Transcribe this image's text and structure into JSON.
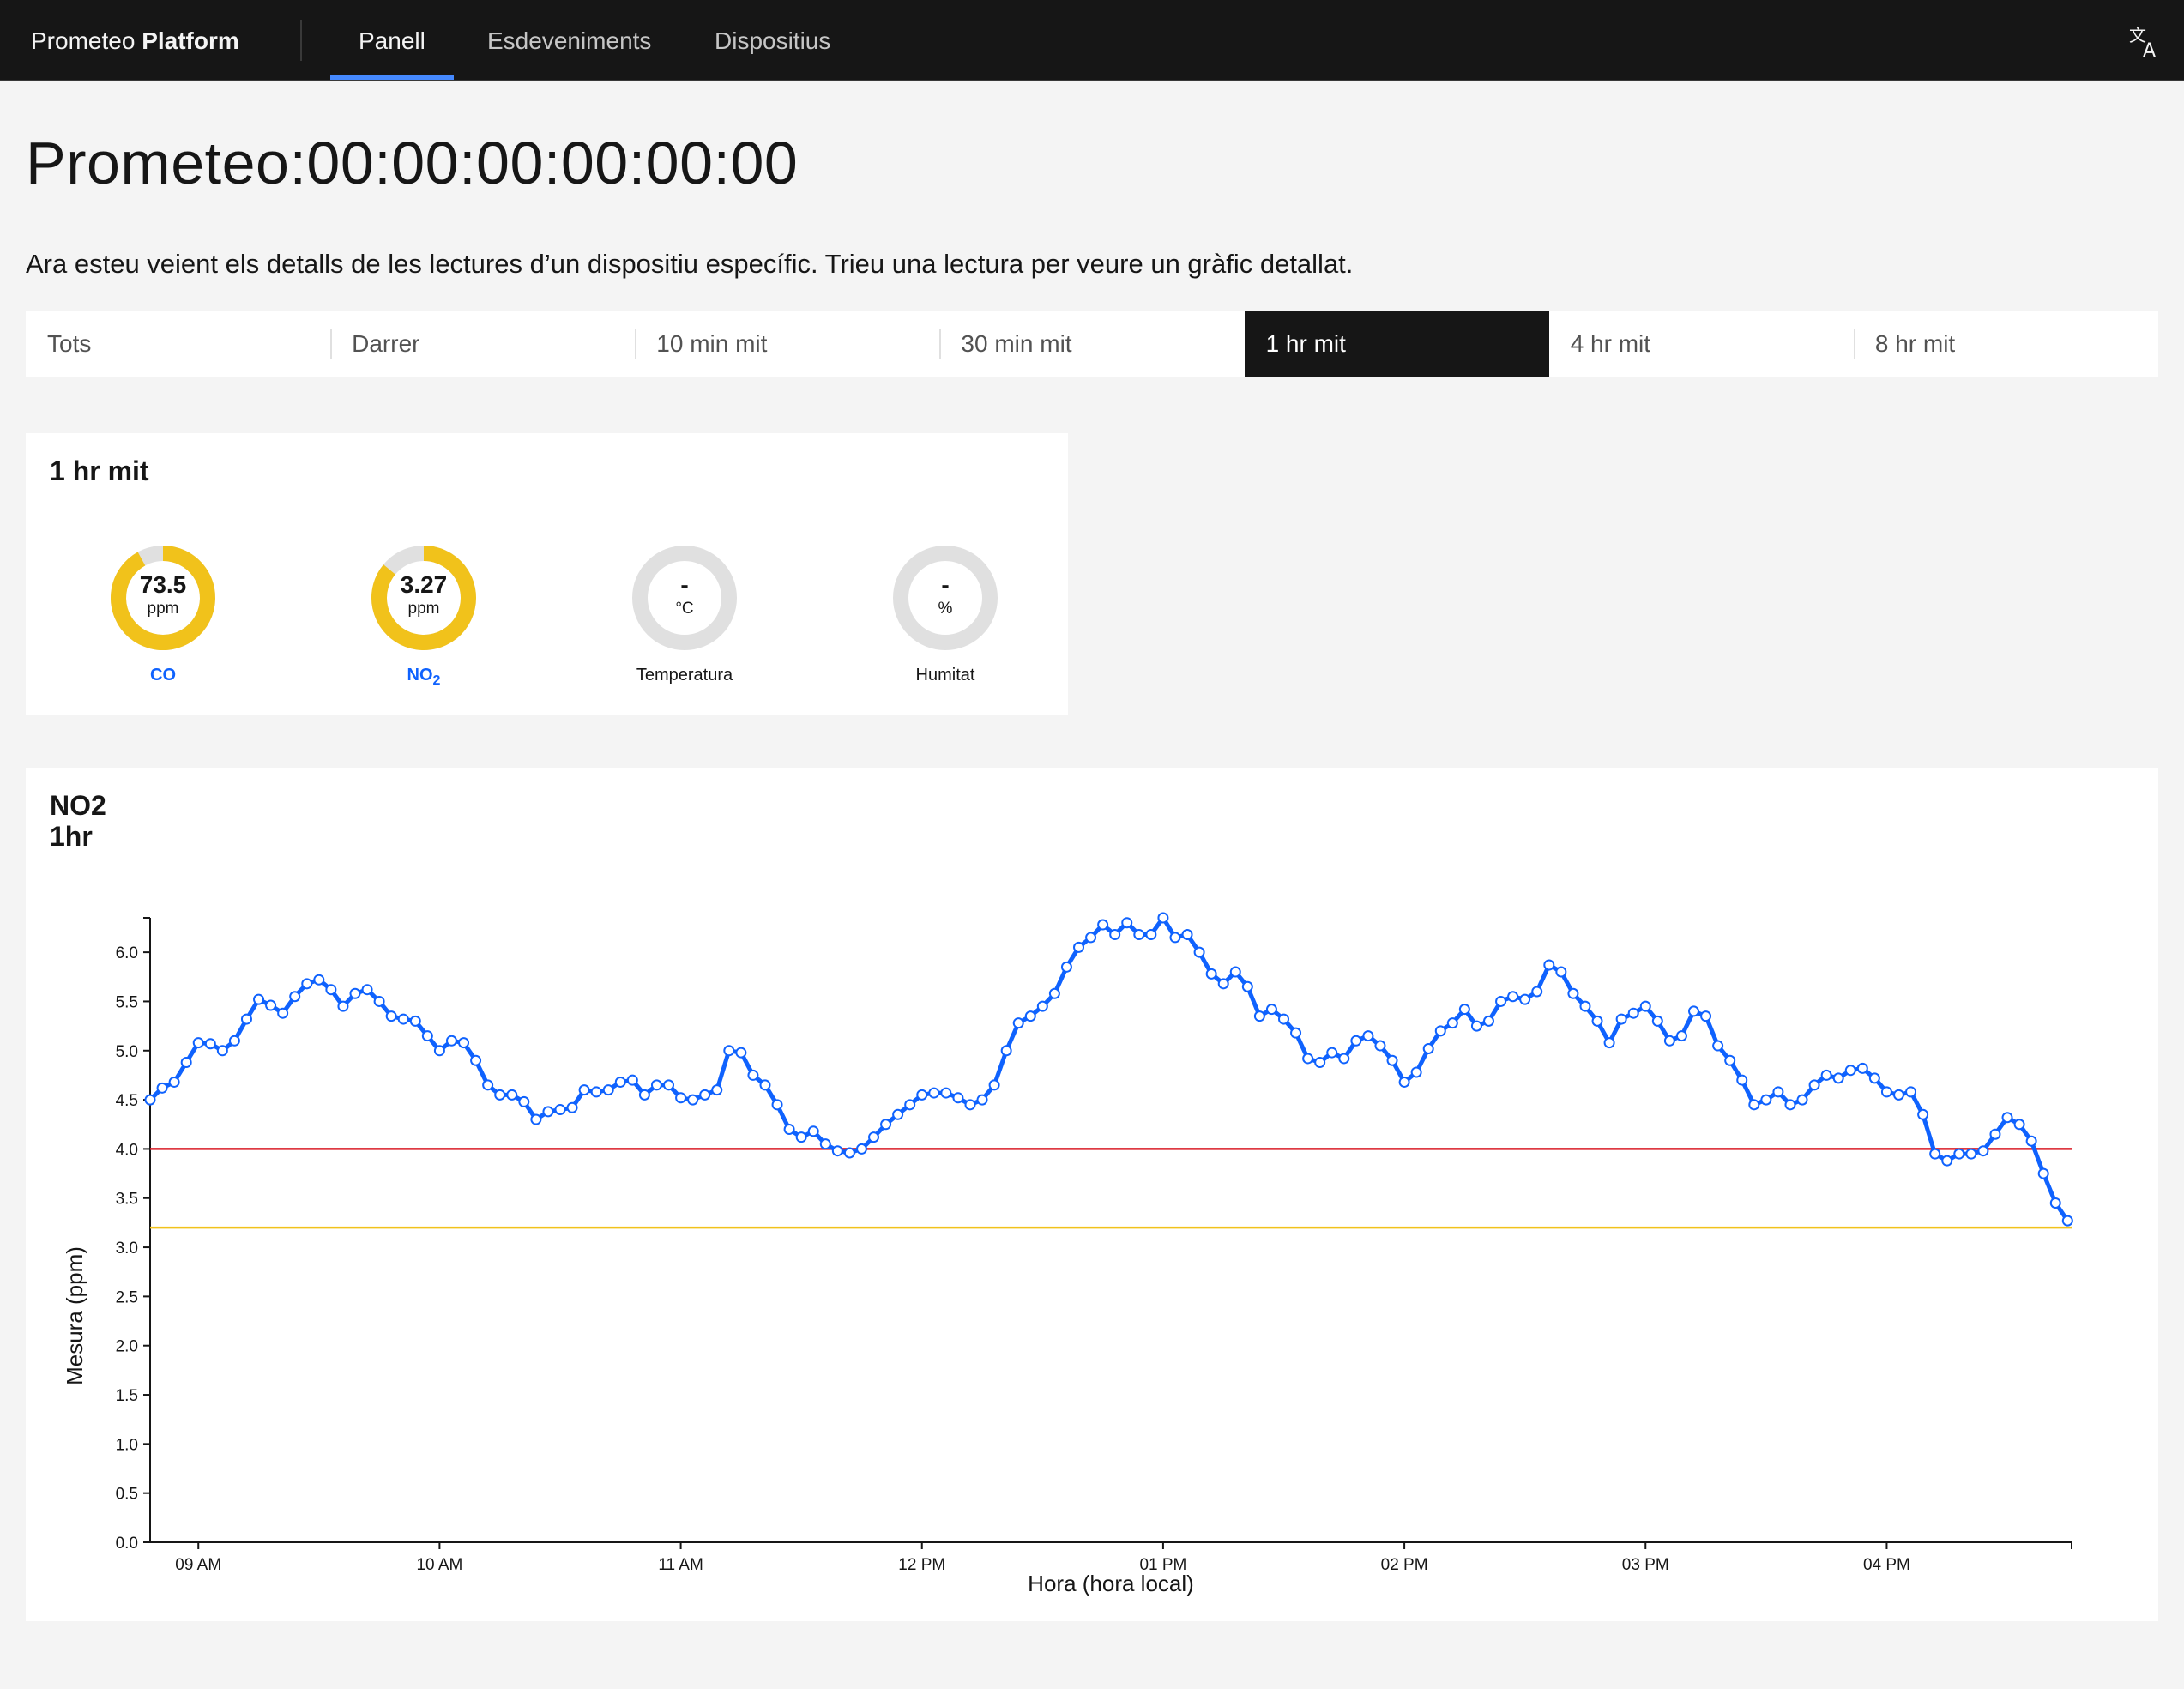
{
  "header": {
    "brand_prefix": "Prometeo",
    "brand_bold": "Platform",
    "nav": [
      {
        "label": "Panell",
        "active": true
      },
      {
        "label": "Esdeveniments",
        "active": false
      },
      {
        "label": "Dispositius",
        "active": false
      }
    ],
    "language_icon": "translate-icon"
  },
  "page": {
    "title": "Prometeo:00:00:00:00:00:00",
    "description": "Ara esteu veient els detalls de les lectures d’un dispositiu específic. Trieu una lectura per veure un gràfic detallat."
  },
  "tabs": [
    {
      "label": "Tots",
      "active": false
    },
    {
      "label": "Darrer",
      "active": false
    },
    {
      "label": "10 min mit",
      "active": false
    },
    {
      "label": "30 min mit",
      "active": false
    },
    {
      "label": "1 hr mit",
      "active": true
    },
    {
      "label": "4 hr mit",
      "active": false
    },
    {
      "label": "8 hr mit",
      "active": false
    }
  ],
  "gauge_card": {
    "title": "1 hr mit",
    "gauges": [
      {
        "value": "73.5",
        "unit": "ppm",
        "label": "CO",
        "fill_fraction": 0.92,
        "color": "#f1c21b"
      },
      {
        "value": "3.27",
        "unit": "ppm",
        "label": "NO",
        "label_sub": "2",
        "fill_fraction": 0.86,
        "color": "#f1c21b"
      },
      {
        "value": "-",
        "unit": "°C",
        "label": "Temperatura",
        "fill_fraction": 0,
        "color": "#e0e0e0"
      },
      {
        "value": "-",
        "unit": "%",
        "label": "Humitat",
        "fill_fraction": 0,
        "color": "#e0e0e0"
      }
    ]
  },
  "colors": {
    "accent": "#0f62fe",
    "series": "#0f62fe",
    "warning_line": "#da1e28",
    "caution_line": "#f1c21b",
    "gauge_fill": "#f1c21b",
    "gauge_track": "#e0e0e0"
  },
  "chart_data": {
    "type": "line",
    "title": "NO2",
    "subtitle": "1hr",
    "xlabel": "Hora (hora local)",
    "ylabel": "Mesura (ppm)",
    "x_ticks": [
      "09 AM",
      "10 AM",
      "11 AM",
      "12 PM",
      "01 PM",
      "02 PM",
      "03 PM",
      "04 PM"
    ],
    "x_range": [
      "08:48",
      "16:46"
    ],
    "ylim": [
      0,
      6.35
    ],
    "y_ticks": [
      0.0,
      0.5,
      1.0,
      1.5,
      2.0,
      2.5,
      3.0,
      3.5,
      4.0,
      4.5,
      5.0,
      5.5,
      6.0
    ],
    "grid": false,
    "reference_lines": [
      {
        "value": 4.0,
        "color": "#da1e28"
      },
      {
        "value": 3.2,
        "color": "#f1c21b"
      }
    ],
    "series": [
      {
        "x_start": "08:48",
        "interval_minutes": 3,
        "values": [
          4.5,
          4.62,
          4.68,
          4.88,
          5.08,
          5.07,
          5.0,
          5.1,
          5.32,
          5.52,
          5.46,
          5.38,
          5.55,
          5.68,
          5.72,
          5.62,
          5.45,
          5.58,
          5.62,
          5.5,
          5.35,
          5.32,
          5.3,
          5.15,
          5.0,
          5.1,
          5.08,
          4.9,
          4.65,
          4.55,
          4.55,
          4.48,
          4.3,
          4.38,
          4.4,
          4.42,
          4.6,
          4.58,
          4.6,
          4.68,
          4.7,
          4.55,
          4.65,
          4.65,
          4.52,
          4.5,
          4.55,
          4.6,
          5.0,
          4.98,
          4.75,
          4.65,
          4.45,
          4.2,
          4.12,
          4.18,
          4.05,
          3.98,
          3.96,
          4.0,
          4.12,
          4.25,
          4.35,
          4.45,
          4.55,
          4.57,
          4.57,
          4.52,
          4.45,
          4.5,
          4.65,
          5.0,
          5.28,
          5.35,
          5.45,
          5.58,
          5.85,
          6.05,
          6.15,
          6.28,
          6.18,
          6.3,
          6.18,
          6.18,
          6.35,
          6.15,
          6.18,
          6.0,
          5.78,
          5.68,
          5.8,
          5.65,
          5.35,
          5.42,
          5.32,
          5.18,
          4.92,
          4.88,
          4.98,
          4.92,
          5.1,
          5.15,
          5.05,
          4.9,
          4.68,
          4.78,
          5.02,
          5.2,
          5.28,
          5.42,
          5.25,
          5.3,
          5.5,
          5.55,
          5.52,
          5.6,
          5.87,
          5.8,
          5.58,
          5.45,
          5.3,
          5.08,
          5.32,
          5.38,
          5.45,
          5.3,
          5.1,
          5.15,
          5.4,
          5.35,
          5.05,
          4.9,
          4.7,
          4.45,
          4.5,
          4.58,
          4.45,
          4.5,
          4.65,
          4.75,
          4.72,
          4.8,
          4.82,
          4.72,
          4.58,
          4.55,
          4.58,
          4.35,
          3.95,
          3.88,
          3.95,
          3.95,
          3.98,
          4.15,
          4.32,
          4.25,
          4.08,
          3.75,
          3.45,
          3.27
        ]
      }
    ]
  }
}
